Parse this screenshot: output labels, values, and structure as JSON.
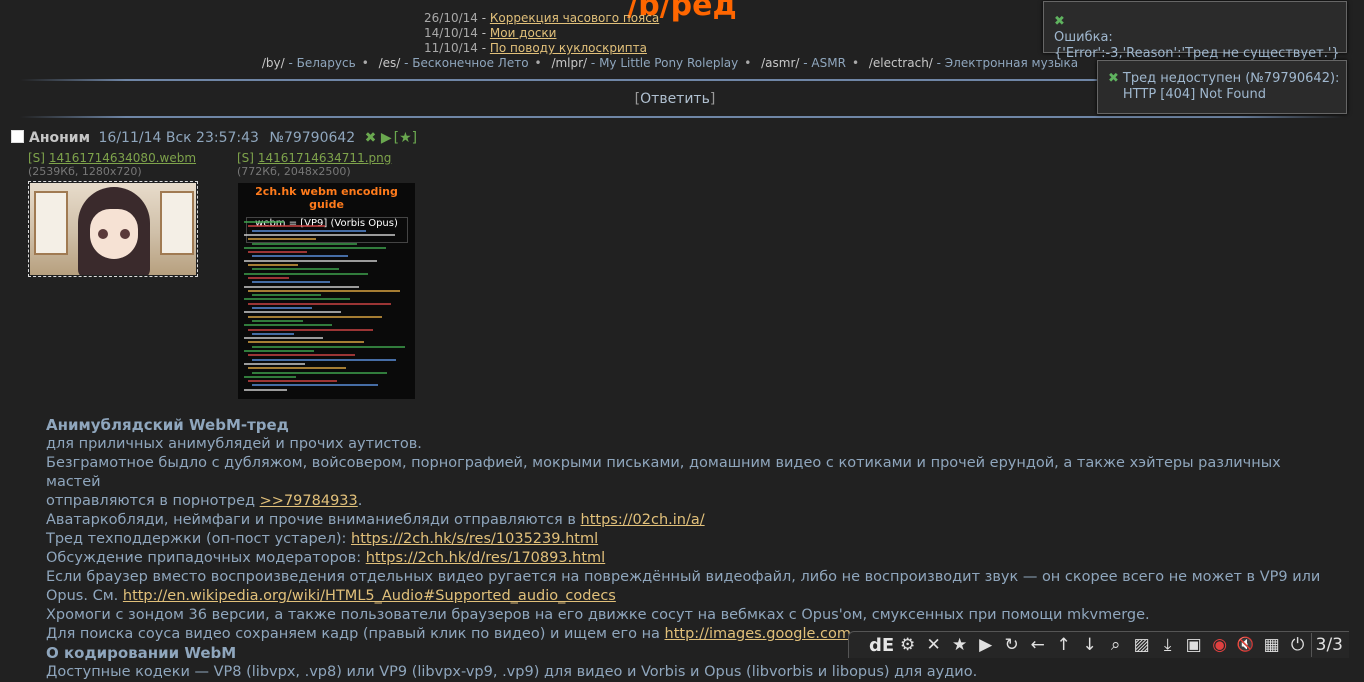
{
  "board": {
    "title": "/b/ред"
  },
  "news": [
    {
      "date": "26/10/14",
      "sep": " - ",
      "text": "Коррекция часового пояса"
    },
    {
      "date": "14/10/14",
      "sep": " - ",
      "text": "Мои доски"
    },
    {
      "date": "11/10/14",
      "sep": " - ",
      "text": "По поводу куклоскрипта"
    }
  ],
  "boardlist": [
    {
      "code": "/by/",
      "name": " - Беларусь"
    },
    {
      "code": "/es/",
      "name": " - Бесконечное Лето"
    },
    {
      "code": "/mlpr/",
      "name": " - My Little Pony Roleplay"
    },
    {
      "code": "/asmr/",
      "name": " - ASMR"
    },
    {
      "code": "/electrach/",
      "name": " - Электронная музыка"
    }
  ],
  "reply": {
    "open": "[",
    "label": "Ответить",
    "close": "]"
  },
  "post": {
    "author": "Аноним",
    "time": "16/11/14 Вск 23:57:43",
    "number": "№79790642",
    "icons": "✖ ▶",
    "star": "[★]",
    "files": [
      {
        "s": "[S]",
        "name": "14161714634080.webm",
        "info": "(2539Кб, 1280x720)"
      },
      {
        "s": "[S]",
        "name": "14161714634711.png",
        "info": "(772Кб, 2048x2500)",
        "thumb_title": "2ch.hk webm encoding guide"
      }
    ],
    "lines": {
      "h1": "Анимублядский WebM-тред",
      "l1": "для приличных анимублядей и прочих аутистов.",
      "l2a": "Безграмотное быдло с дубляжом, войсовером, порнографией, мокрыми письками, домашним видео с котиками и прочей ерундой, а также хэйтеры различных мастей",
      "l2b": "отправляются в порнотред ",
      "l2link": ">>79784933",
      "l2end": ".",
      "l3": "Аватаркобляди, неймфаги и прочие вниманиебляди отправляются в ",
      "l3link": "https://02ch.in/a/",
      "l4": "Тред техподдержки (оп-пост устарел): ",
      "l4link": "https://2ch.hk/s/res/1035239.html",
      "l5": "Обсуждение припадочных модераторов: ",
      "l5link": "https://2ch.hk/d/res/170893.html",
      "l6a": "Если браузер вместо воспроизведения отдельных видео ругается на повреждённый видеофайл, либо не воспроизводит звук — он скорее всего не может в VP9 или",
      "l6b": "Opus. См. ",
      "l6link": "http://en.wikipedia.org/wiki/HTML5_Audio#Supported_audio_codecs",
      "l7": "Хромоги с зондом 36 версии, а также пользователи браузеров на его движке сосут на вебмках с Opus'ом, смуксенных при помощи mkvmerge.",
      "l8": "Для поиска соуса видео сохраняем кадр (правый клик по видео) и ищем его на ",
      "l8link": "http://images.google.com.",
      "h2": "О кодировании WebM",
      "l9": "Доступные кодеки — VP8 (libvpx, .vp8) или VP9 (libvpx-vp9, .vp9) для видео и Vorbis и Opus (libvorbis и libopus) для аудио."
    }
  },
  "notices": [
    {
      "icon": "✖",
      "title": "Ошибка:",
      "text": "{'Error':-3,'Reason':'Тред не существует.'}"
    },
    {
      "icon": "✖",
      "title": "Тред недоступен (№79790642):",
      "text": "HTTP [404] Not Found"
    }
  ],
  "toolbar": {
    "logo": "dE",
    "counter": "3/3",
    "buttons": [
      {
        "name": "settings-icon",
        "glyph": "⚙"
      },
      {
        "name": "close-icon",
        "glyph": "✕"
      },
      {
        "name": "favorites-icon",
        "glyph": "★"
      },
      {
        "name": "play-icon",
        "glyph": "▶"
      },
      {
        "name": "refresh-icon",
        "glyph": "↻"
      },
      {
        "name": "arrow-left-icon",
        "glyph": "←"
      },
      {
        "name": "arrow-up-icon",
        "glyph": "↑"
      },
      {
        "name": "arrow-down-icon",
        "glyph": "↓"
      },
      {
        "name": "zoom-icon",
        "glyph": "⌕"
      },
      {
        "name": "hatch-icon",
        "glyph": "▨"
      },
      {
        "name": "download-icon",
        "glyph": "⤓"
      },
      {
        "name": "save-icon",
        "glyph": "▣"
      },
      {
        "name": "eye-icon",
        "glyph": "◉"
      },
      {
        "name": "mute-icon",
        "glyph": "🔇"
      },
      {
        "name": "grid-icon",
        "glyph": "▦"
      },
      {
        "name": "power-icon",
        "glyph": "⏻"
      }
    ]
  }
}
